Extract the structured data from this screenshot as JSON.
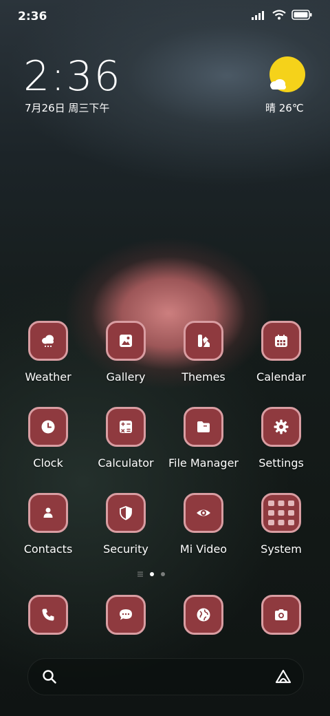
{
  "status_bar": {
    "time": "2:36"
  },
  "clock_widget": {
    "time": "2:36",
    "date": "7月26日 周三下午"
  },
  "weather_widget": {
    "text": "晴 26℃",
    "icon": "sun-cloud-icon"
  },
  "apps": [
    {
      "label": "Weather",
      "icon": "weather-icon"
    },
    {
      "label": "Gallery",
      "icon": "gallery-icon"
    },
    {
      "label": "Themes",
      "icon": "themes-icon"
    },
    {
      "label": "Calendar",
      "icon": "calendar-icon"
    },
    {
      "label": "Clock",
      "icon": "clock-icon"
    },
    {
      "label": "Calculator",
      "icon": "calculator-icon"
    },
    {
      "label": "File Manager",
      "icon": "folder-icon"
    },
    {
      "label": "Settings",
      "icon": "gear-icon"
    },
    {
      "label": "Contacts",
      "icon": "contact-icon"
    },
    {
      "label": "Security",
      "icon": "shield-icon"
    },
    {
      "label": "Mi Video",
      "icon": "eye-icon"
    },
    {
      "label": "System",
      "icon": "folder-grid-icon"
    }
  ],
  "dock": [
    {
      "icon": "phone-icon"
    },
    {
      "icon": "message-icon"
    },
    {
      "icon": "browser-icon"
    },
    {
      "icon": "camera-icon"
    }
  ],
  "page_indicator": {
    "pages": 2,
    "current": 1
  },
  "colors": {
    "icon_fill": "#8f3a3f",
    "icon_border": "#d99da2",
    "weather_sun": "#f5d21a"
  }
}
